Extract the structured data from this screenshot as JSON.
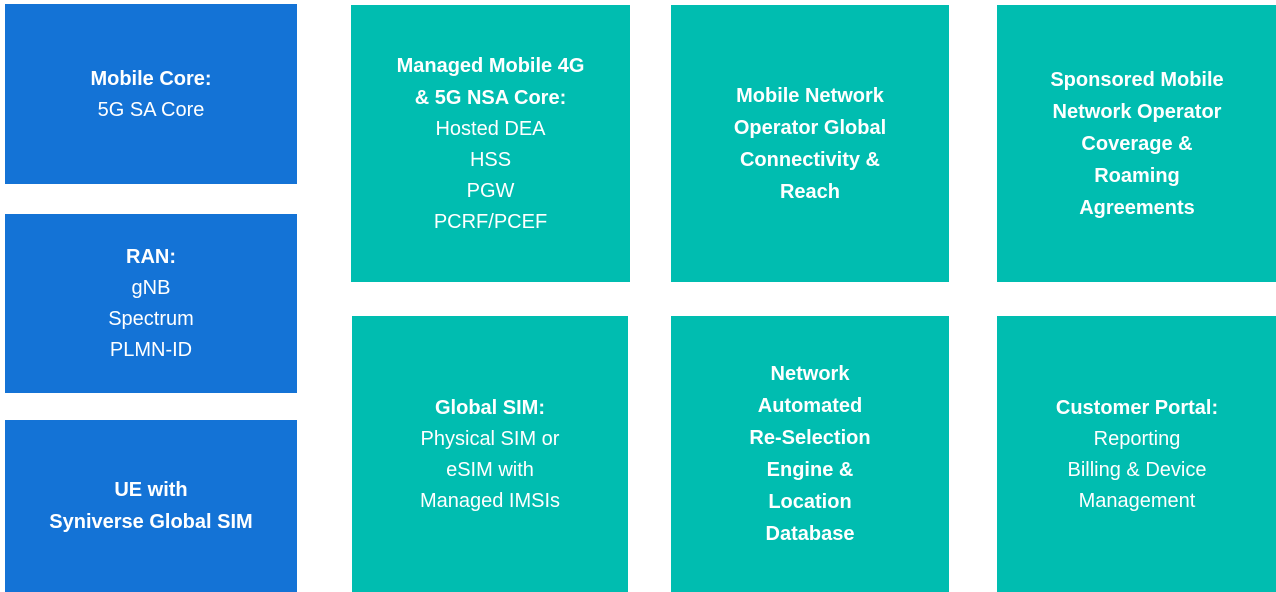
{
  "colors": {
    "blue": "#1473d6",
    "teal": "#00bdb0",
    "text": "#ffffff"
  },
  "tiles": {
    "mobile_core": {
      "title": "Mobile Core:",
      "lines": [
        "5G SA Core"
      ]
    },
    "ran": {
      "title": "RAN:",
      "lines": [
        "gNB",
        "Spectrum",
        "PLMN-ID"
      ]
    },
    "ue": {
      "title": "UE with\nSyniverse Global SIM",
      "lines": []
    },
    "managed_mobile": {
      "title": "Managed Mobile 4G\n& 5G NSA Core:",
      "lines": [
        "Hosted DEA",
        "HSS",
        "PGW",
        "PCRF/PCEF"
      ]
    },
    "mno_global": {
      "title": "Mobile Network\nOperator Global\nConnectivity &\nReach",
      "lines": []
    },
    "sponsored": {
      "title": "Sponsored Mobile\nNetwork Operator\nCoverage &\nRoaming\nAgreements",
      "lines": []
    },
    "global_sim": {
      "title": "Global SIM:",
      "lines": [
        "Physical SIM or",
        "eSIM with",
        "Managed IMSIs"
      ]
    },
    "network_automated": {
      "title": "Network\nAutomated\nRe-Selection\nEngine &\nLocation\nDatabase",
      "lines": []
    },
    "customer_portal": {
      "title": "Customer Portal:",
      "lines": [
        "Reporting",
        "Billing & Device",
        "Management"
      ]
    }
  }
}
